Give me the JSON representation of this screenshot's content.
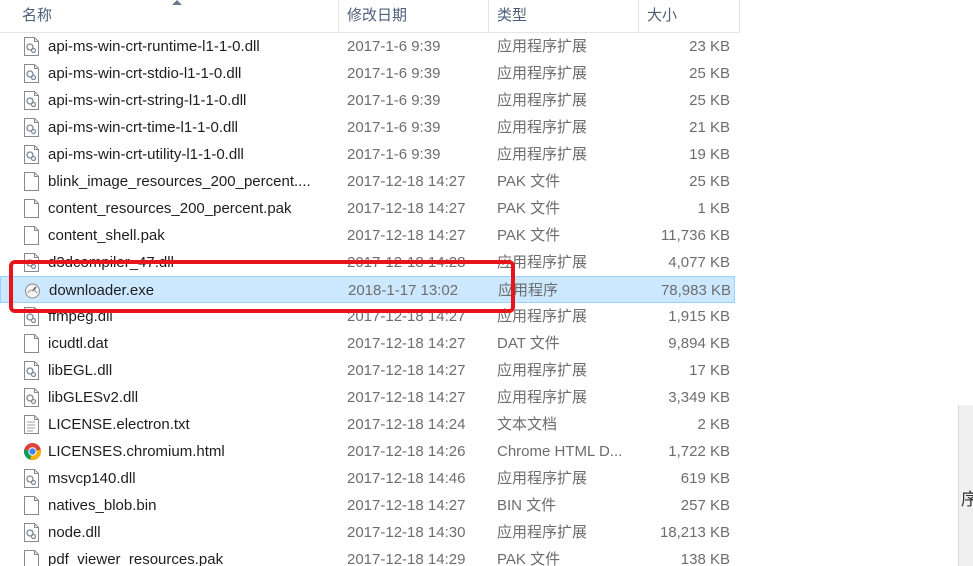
{
  "columns": {
    "name": "名称",
    "date": "修改日期",
    "type": "类型",
    "size": "大小"
  },
  "files": [
    {
      "name": "api-ms-win-crt-runtime-l1-1-0.dll",
      "date": "2017-1-6 9:39",
      "type": "应用程序扩展",
      "size": "23 KB",
      "icon": "dll-file-icon"
    },
    {
      "name": "api-ms-win-crt-stdio-l1-1-0.dll",
      "date": "2017-1-6 9:39",
      "type": "应用程序扩展",
      "size": "25 KB",
      "icon": "dll-file-icon"
    },
    {
      "name": "api-ms-win-crt-string-l1-1-0.dll",
      "date": "2017-1-6 9:39",
      "type": "应用程序扩展",
      "size": "25 KB",
      "icon": "dll-file-icon"
    },
    {
      "name": "api-ms-win-crt-time-l1-1-0.dll",
      "date": "2017-1-6 9:39",
      "type": "应用程序扩展",
      "size": "21 KB",
      "icon": "dll-file-icon"
    },
    {
      "name": "api-ms-win-crt-utility-l1-1-0.dll",
      "date": "2017-1-6 9:39",
      "type": "应用程序扩展",
      "size": "19 KB",
      "icon": "dll-file-icon"
    },
    {
      "name": "blink_image_resources_200_percent....",
      "date": "2017-12-18 14:27",
      "type": "PAK 文件",
      "size": "25 KB",
      "icon": "blank-file-icon"
    },
    {
      "name": "content_resources_200_percent.pak",
      "date": "2017-12-18 14:27",
      "type": "PAK 文件",
      "size": "1 KB",
      "icon": "blank-file-icon"
    },
    {
      "name": "content_shell.pak",
      "date": "2017-12-18 14:27",
      "type": "PAK 文件",
      "size": "11,736 KB",
      "icon": "blank-file-icon"
    },
    {
      "name": "d3dcompiler_47.dll",
      "date": "2017-12-18 14:28",
      "type": "应用程序扩展",
      "size": "4,077 KB",
      "icon": "dll-file-icon"
    },
    {
      "name": "downloader.exe",
      "date": "2018-1-17 13:02",
      "type": "应用程序",
      "size": "78,983 KB",
      "icon": "exe-app-icon",
      "selected": true
    },
    {
      "name": "ffmpeg.dll",
      "date": "2017-12-18 14:27",
      "type": "应用程序扩展",
      "size": "1,915 KB",
      "icon": "dll-file-icon"
    },
    {
      "name": "icudtl.dat",
      "date": "2017-12-18 14:27",
      "type": "DAT 文件",
      "size": "9,894 KB",
      "icon": "blank-file-icon"
    },
    {
      "name": "libEGL.dll",
      "date": "2017-12-18 14:27",
      "type": "应用程序扩展",
      "size": "17 KB",
      "icon": "dll-file-icon"
    },
    {
      "name": "libGLESv2.dll",
      "date": "2017-12-18 14:27",
      "type": "应用程序扩展",
      "size": "3,349 KB",
      "icon": "dll-file-icon"
    },
    {
      "name": "LICENSE.electron.txt",
      "date": "2017-12-18 14:24",
      "type": "文本文档",
      "size": "2 KB",
      "icon": "text-file-icon"
    },
    {
      "name": "LICENSES.chromium.html",
      "date": "2017-12-18 14:26",
      "type": "Chrome HTML D...",
      "size": "1,722 KB",
      "icon": "chrome-icon"
    },
    {
      "name": "msvcp140.dll",
      "date": "2017-12-18 14:46",
      "type": "应用程序扩展",
      "size": "619 KB",
      "icon": "dll-file-icon"
    },
    {
      "name": "natives_blob.bin",
      "date": "2017-12-18 14:27",
      "type": "BIN 文件",
      "size": "257 KB",
      "icon": "blank-file-icon"
    },
    {
      "name": "node.dll",
      "date": "2017-12-18 14:30",
      "type": "应用程序扩展",
      "size": "18,213 KB",
      "icon": "dll-file-icon"
    },
    {
      "name": "pdf_viewer_resources.pak",
      "date": "2017-12-18 14:29",
      "type": "PAK 文件",
      "size": "138 KB",
      "icon": "blank-file-icon"
    }
  ],
  "right_edge_glyph": "序",
  "colors": {
    "selection": "#cce8ff",
    "highlight_box": "#e8141c"
  }
}
